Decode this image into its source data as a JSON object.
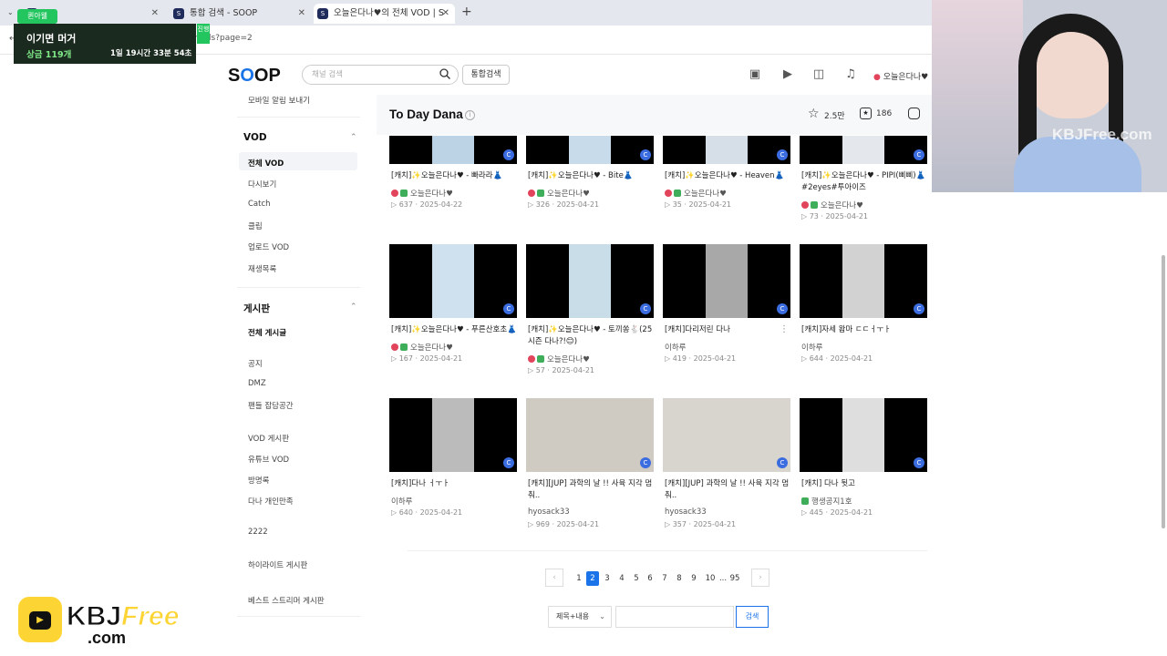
{
  "browser": {
    "tabs": [
      {
        "label": "P",
        "active": false
      },
      {
        "label": "통합 검색 - SOOP",
        "active": false
      },
      {
        "label": "오늘은다나♥의 전체 VOD | S",
        "active": true
      }
    ],
    "new_tab": "+",
    "url": "ch.sooplive.co.kr/skvl04/vods?page=2"
  },
  "overlay": {
    "tag": "퀸아웰",
    "live": "진행",
    "title": "이기면 머거",
    "prize": "상금 119개",
    "timer": "1일 19시간 33분 54초"
  },
  "header": {
    "logo": "SOOP",
    "search_placeholder": "채널 검색",
    "all_search": "통합검색",
    "user": "오늘은다나♥"
  },
  "sidebar": {
    "top_item": "모바일 알림 보내기",
    "vod_heading": "VOD",
    "vod_items": [
      "전체 VOD",
      "다시보기",
      "Catch",
      "클립",
      "업로드 VOD",
      "재생목록"
    ],
    "board_heading": "게시판",
    "board_items": [
      "전체 게시글",
      "공지",
      "DMZ",
      "팬들 잡담공간",
      "VOD 게시판",
      "유튜브 VOD",
      "방명록",
      "다나 개인만족",
      "2222",
      "하이라이트 게시판",
      "베스트 스트리머 게시판"
    ]
  },
  "channel": {
    "title": "To Day Dana",
    "favorites": "2.5만",
    "subs": "186"
  },
  "cards": [
    {
      "title": "[캐치]✨오늘은다나♥ - 빠라라👗",
      "author": "오늘은다나♥",
      "views": "637",
      "date": "2025-04-22"
    },
    {
      "title": "[캐치]✨오늘은다나♥ - Bite👗",
      "author": "오늘은다나♥",
      "views": "326",
      "date": "2025-04-21"
    },
    {
      "title": "[캐치]✨오늘은다나♥ - Heaven👗",
      "author": "오늘은다나♥",
      "views": "35",
      "date": "2025-04-21"
    },
    {
      "title": "[캐치]✨오늘은다나♥ - PIPI(삐삐)👗#2eyes#투아이즈",
      "author": "오늘은다나♥",
      "views": "73",
      "date": "2025-04-21"
    },
    {
      "title": "[캐치]✨오늘은다나♥ - 푸른산호초👗",
      "author": "오늘은다나♥",
      "views": "167",
      "date": "2025-04-21"
    },
    {
      "title": "[캐치]✨오늘은다나♥ - 토끼쏭🐇(25시즌 다나?!😊)",
      "author": "오늘은다나♥",
      "views": "57",
      "date": "2025-04-21"
    },
    {
      "title": "[캐치]다리저린 다나",
      "author": "이하루",
      "views": "419",
      "date": "2025-04-21"
    },
    {
      "title": "[캐치]자세 왐마 ㄷㄷㅓㅜㅏ",
      "author": "이하루",
      "views": "644",
      "date": "2025-04-21"
    },
    {
      "title": "[캐치]다나 ㅓㅜㅏ",
      "author": "이하루",
      "views": "640",
      "date": "2025-04-21"
    },
    {
      "title": "[캐치][JUP] 과학의 날 !! 사육 지각 멈춰..",
      "author": "hyosack33",
      "views": "969",
      "date": "2025-04-21"
    },
    {
      "title": "[캐치][JUP] 과학의 날 !! 사육 지각 멈춰..",
      "author": "hyosack33",
      "views": "357",
      "date": "2025-04-21"
    },
    {
      "title": "[캐치] 다나 뒷고",
      "author": "행생공지1호",
      "views": "445",
      "date": "2025-04-21"
    }
  ],
  "pagination": {
    "pages": [
      "1",
      "2",
      "3",
      "4",
      "5",
      "6",
      "7",
      "8",
      "9",
      "10",
      "...",
      "95"
    ],
    "current": "2",
    "prev": "‹",
    "next": "›"
  },
  "bottom_search": {
    "select": "제목+내용",
    "button": "검색"
  },
  "watermarks": {
    "cam": "KBJFree.com",
    "logo_top": "KBJ",
    "logo_free": "Free",
    "logo_com": ".com"
  },
  "colors": {
    "accent": "#1a73e8",
    "overlay_bg": "#1b2a1f",
    "overlay_tag": "#22c55e",
    "prize": "#7ee787"
  }
}
